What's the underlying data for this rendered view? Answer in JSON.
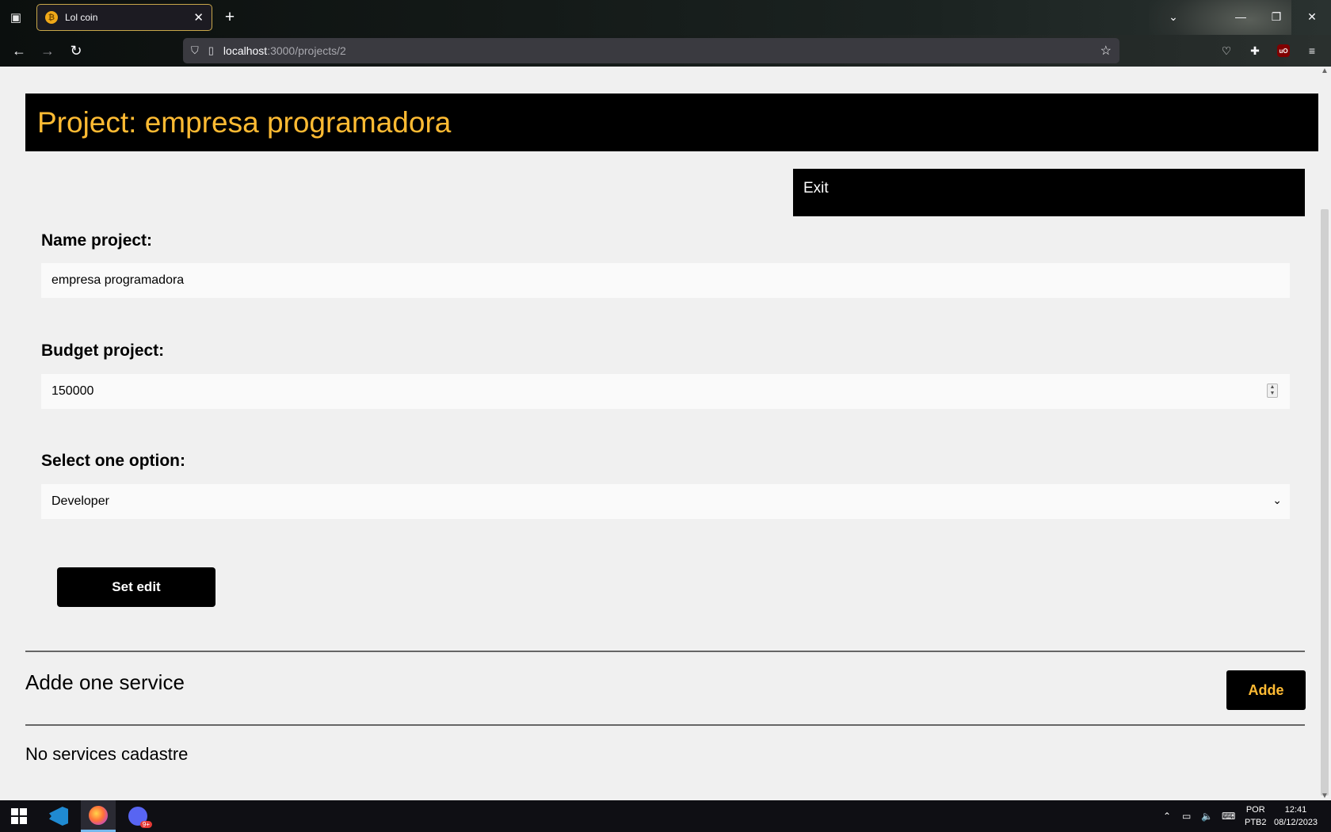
{
  "browser": {
    "tab_title": "Lol coin",
    "url_host": "localhost",
    "url_path": ":3000/projects/2"
  },
  "page": {
    "header_title": "Project: empresa programadora",
    "exit_label": "Exit",
    "name_label": "Name project:",
    "name_value": "empresa programadora",
    "budget_label": "Budget project:",
    "budget_value": "150000",
    "category_label": "Select one option:",
    "category_value": "Developer",
    "submit_label": "Set edit",
    "service_title": "Adde one service",
    "add_label": "Adde",
    "empty_message": "No services cadastre"
  },
  "taskbar": {
    "discord_badge": "9+",
    "lang_top": "POR",
    "lang_bottom": "PTB2",
    "time": "12:41",
    "date": "08/12/2023"
  },
  "colors": {
    "accent": "#ffbb33",
    "header_bg": "#000000",
    "page_bg": "#f0f0f0"
  }
}
